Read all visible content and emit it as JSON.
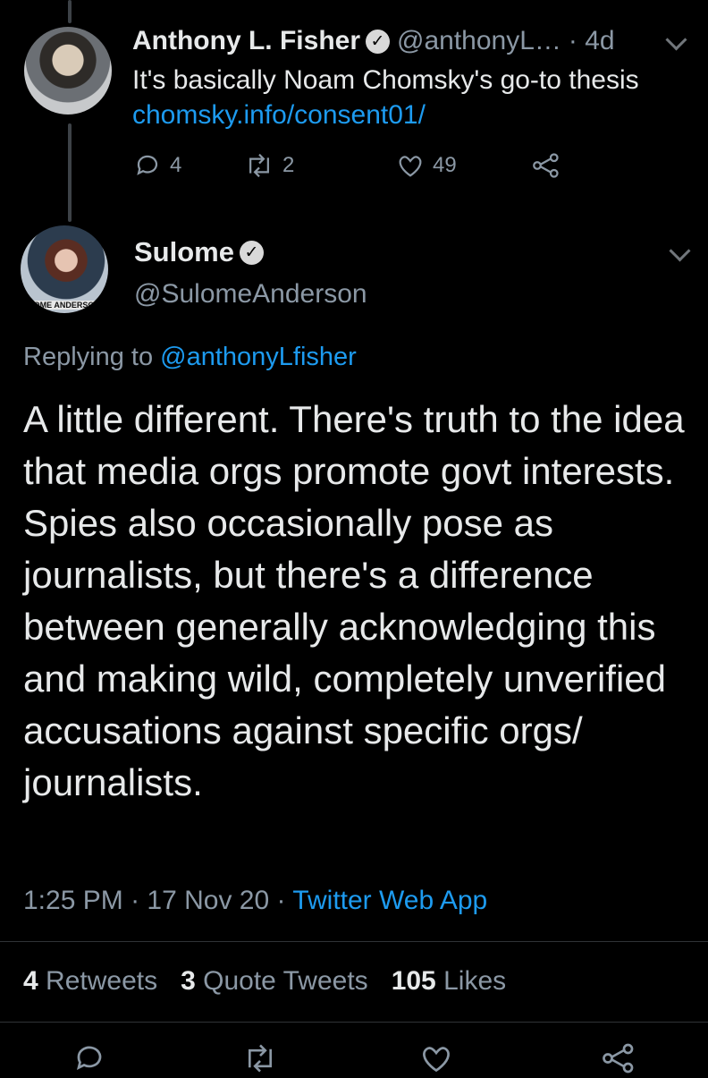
{
  "reply_tweet": {
    "author_name": "Anthony L. Fisher",
    "handle": "@anthonyL…",
    "time": "· 4d",
    "text_before_link": "It's basically Noam Chomsky's go-to thesis ",
    "link_text": "chomsky.info/consent01/",
    "reply_count": "4",
    "retweet_count": "2",
    "like_count": "49",
    "icons": [
      "reply-icon",
      "retweet-icon",
      "like-icon",
      "share-icon"
    ]
  },
  "main_tweet": {
    "author_name": "Sulome",
    "handle": "@SulomeAnderson",
    "avatar_caption": "LOME ANDERSON",
    "replying_prefix": "Replying to ",
    "replying_handle": "@anthonyLfisher",
    "text": "A little different. There's truth to the idea that media orgs promote govt interests.  Spies also occasionally pose as journalists, but there's a difference between generally acknowledging this and making wild, completely unverified accusations against specific orgs/ journalists.",
    "time": "1:25 PM",
    "date": "17 Nov 20",
    "separator": "·",
    "source": "Twitter Web App",
    "stats": {
      "retweets_count": "4",
      "retweets_label": "Retweets",
      "quotes_count": "3",
      "quotes_label": "Quote Tweets",
      "likes_count": "105",
      "likes_label": "Likes"
    }
  },
  "colors": {
    "background": "#000000",
    "link": "#1d9bf0",
    "muted": "#8b98a5",
    "text": "#e7e9ea"
  }
}
